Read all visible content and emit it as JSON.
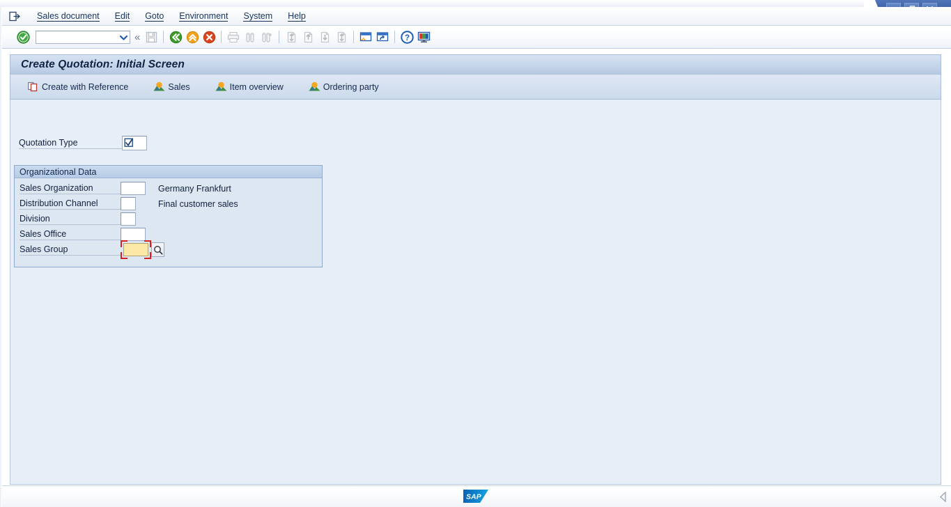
{
  "window": {
    "controls": [
      {
        "name": "minimize",
        "glyph": "minimize-icon"
      },
      {
        "name": "restore",
        "glyph": "restore-icon"
      },
      {
        "name": "close",
        "glyph": "close-icon"
      }
    ]
  },
  "menubar": {
    "system_icon": "system-menu-icon",
    "items": [
      {
        "label": "Sales document",
        "accel_index": 0
      },
      {
        "label": "Edit",
        "accel_index": 0
      },
      {
        "label": "Goto",
        "accel_index": 0
      },
      {
        "label": "Environment",
        "accel_index": 3
      },
      {
        "label": "System",
        "accel_index": 1
      },
      {
        "label": "Help",
        "accel_index": 1
      }
    ]
  },
  "toolbar": {
    "enter_icon": "green-check-enter-icon",
    "command_field": {
      "value": "",
      "placeholder": "",
      "dropdown_icon": "chevron-down-icon"
    },
    "collapse_icon": "double-chevron-left-icon",
    "buttons": [
      {
        "name": "save-button",
        "icon": "save-floppy-icon",
        "enabled": false
      },
      {
        "name": "back-button",
        "icon": "green-back-arrow-icon",
        "enabled": true
      },
      {
        "name": "exit-button",
        "icon": "orange-up-arrow-icon",
        "enabled": true
      },
      {
        "name": "cancel-button",
        "icon": "red-cancel-icon",
        "enabled": true
      },
      {
        "name": "print-button",
        "icon": "printer-icon",
        "enabled": false
      },
      {
        "name": "find-button",
        "icon": "binoculars-icon",
        "enabled": false
      },
      {
        "name": "find-next-button",
        "icon": "binoculars-plus-icon",
        "enabled": false
      },
      {
        "name": "first-page-button",
        "icon": "first-page-icon",
        "enabled": false
      },
      {
        "name": "previous-page-button",
        "icon": "previous-page-icon",
        "enabled": false
      },
      {
        "name": "next-page-button",
        "icon": "next-page-icon",
        "enabled": false
      },
      {
        "name": "last-page-button",
        "icon": "last-page-icon",
        "enabled": false
      },
      {
        "name": "create-session-button",
        "icon": "new-session-icon",
        "enabled": true
      },
      {
        "name": "create-shortcut-button",
        "icon": "shortcut-icon",
        "enabled": true
      },
      {
        "name": "help-button",
        "icon": "help-question-icon",
        "enabled": true
      },
      {
        "name": "customize-button",
        "icon": "customize-monitor-icon",
        "enabled": true
      }
    ]
  },
  "screen": {
    "title": "Create Quotation: Initial Screen"
  },
  "app_toolbar": {
    "buttons": [
      {
        "label": "Create with Reference",
        "icon": "copy-reference-icon"
      },
      {
        "label": "Sales",
        "icon": "overview-picture-icon"
      },
      {
        "label": "Item overview",
        "icon": "overview-picture-icon"
      },
      {
        "label": "Ordering party",
        "icon": "overview-picture-icon"
      }
    ]
  },
  "form": {
    "quotation_type": {
      "label": "Quotation Type",
      "value": "",
      "help_icon": "checkbox-check-icon"
    },
    "organizational_data": {
      "title": "Organizational Data",
      "rows": [
        {
          "label": "Sales Organization",
          "value": "",
          "description": "Germany Frankfurt",
          "input_size": "wide",
          "focused": false,
          "has_search_help": false
        },
        {
          "label": "Distribution Channel",
          "value": "",
          "description": "Final customer sales",
          "input_size": "narrow",
          "focused": false,
          "has_search_help": false
        },
        {
          "label": "Division",
          "value": "",
          "description": "",
          "input_size": "narrow",
          "focused": false,
          "has_search_help": false
        },
        {
          "label": "Sales Office",
          "value": "",
          "description": "",
          "input_size": "wide",
          "focused": false,
          "has_search_help": false
        },
        {
          "label": "Sales Group",
          "value": "",
          "description": "",
          "input_size": "wide",
          "focused": true,
          "has_search_help": true,
          "search_help_icon": "magnifier-search-help-icon"
        }
      ]
    }
  },
  "statusbar": {
    "logo_text": "SAP",
    "logo_name": "sap-logo",
    "resize_grip_icon": "resize-grip-icon"
  },
  "colors": {
    "app_background": "#e8eef7",
    "group_background": "#dde7f2",
    "title_gradient_top": "#d6e2f1",
    "title_gradient_bottom": "#b7cae2",
    "focus_red": "#d92020",
    "focused_field_yellow": "#fce9a8",
    "sap_blue": "#0a7fc4",
    "menu_text": "#16325c"
  }
}
